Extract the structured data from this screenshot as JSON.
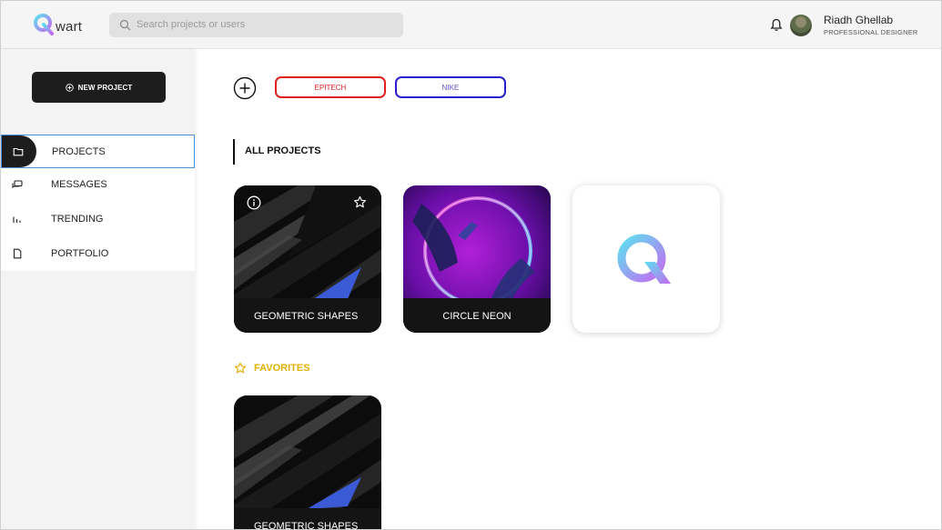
{
  "app": {
    "logo_text": "wart",
    "brand_gradient": [
      "#5ee0f0",
      "#c46bf0"
    ]
  },
  "search": {
    "placeholder": "Search projects or users"
  },
  "user": {
    "name": "Riadh Ghellab",
    "role": "PROFESSIONAL DESIGNER"
  },
  "icons": {
    "search": "search-icon",
    "bell": "bell-icon",
    "plus": "plus-circle-icon",
    "folder": "folder-icon",
    "messages": "chat-icon",
    "trending": "bar-chart-icon",
    "portfolio": "document-icon",
    "info": "info-icon",
    "star": "star-icon"
  },
  "sidebar": {
    "new_project_label": "NEW PROJECT",
    "items": [
      {
        "label": "PROJECTS",
        "icon": "folder-icon",
        "active": true
      },
      {
        "label": "MESSAGES",
        "icon": "chat-icon",
        "active": false
      },
      {
        "label": "TRENDING",
        "icon": "bar-chart-icon",
        "active": false
      },
      {
        "label": "PORTFOLIO",
        "icon": "document-icon",
        "active": false
      }
    ]
  },
  "tags": [
    {
      "label": "EPITECH",
      "color": "#e0201c"
    },
    {
      "label": "NIKE",
      "color": "#2a1fd0"
    }
  ],
  "sections": {
    "all_projects": "ALL PROJECTS",
    "favorites": "FAVORITES",
    "favorites_color": "#e2b100"
  },
  "projects": [
    {
      "title": "GEOMETRIC SHAPES",
      "style": "dark-geometric"
    },
    {
      "title": "CIRCLE NEON",
      "style": "neon-circle"
    },
    {
      "title": "",
      "style": "logo"
    }
  ],
  "favorites": [
    {
      "title": "GEOMETRIC SHAPES",
      "style": "dark-geometric"
    }
  ]
}
